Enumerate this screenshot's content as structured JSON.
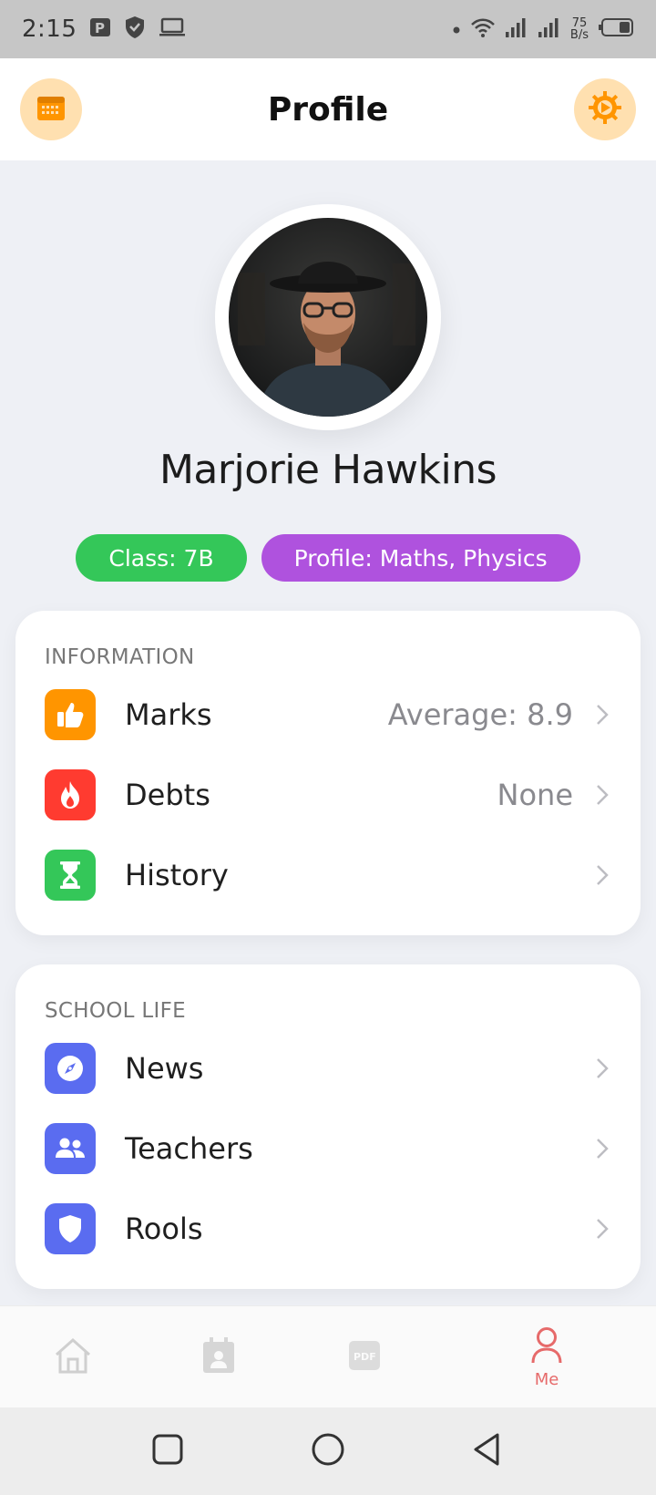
{
  "status_bar": {
    "time": "2:15",
    "network_speed_value": "75",
    "network_speed_unit": "B/s",
    "left_icons": [
      "parking-app-icon",
      "shield-icon",
      "laptop-icon"
    ],
    "right_icons": [
      "dot-icon",
      "wifi-icon",
      "signal-icon",
      "signal-icon",
      "battery-icon"
    ]
  },
  "header": {
    "title": "Profile",
    "left_button_icon": "calendar-icon",
    "right_button_icon": "settings-gear-icon"
  },
  "profile": {
    "name": "Marjorie Hawkins",
    "avatar": "profile-photo",
    "chips": [
      {
        "label": "Class: 7B",
        "color": "#34c759"
      },
      {
        "label": "Profile: Maths, Physics",
        "color": "#af52de"
      }
    ]
  },
  "information": {
    "title": "INFORMATION",
    "items": [
      {
        "label": "Marks",
        "value": "Average: 8.9",
        "icon": "thumbs-up-icon",
        "color": "#ff9500"
      },
      {
        "label": "Debts",
        "value": "None",
        "icon": "fire-icon",
        "color": "#ff3b30"
      },
      {
        "label": "History",
        "value": "",
        "icon": "hourglass-icon",
        "color": "#34c759"
      }
    ]
  },
  "school_life": {
    "title": "SCHOOL LIFE",
    "items": [
      {
        "label": "News",
        "icon": "compass-icon",
        "color": "#5a6cf0"
      },
      {
        "label": "Teachers",
        "icon": "people-icon",
        "color": "#5a6cf0"
      },
      {
        "label": "Rools",
        "icon": "shield-icon",
        "color": "#5a6cf0"
      }
    ]
  },
  "bottom_nav": {
    "items": [
      {
        "icon": "home-icon",
        "label": ""
      },
      {
        "icon": "schedule-icon",
        "label": ""
      },
      {
        "icon": "pdf-icon",
        "label": ""
      },
      {
        "icon": "person-icon",
        "label": "Me",
        "active": true
      }
    ],
    "active_color": "#e66a6a"
  },
  "system_nav": [
    "recents-button",
    "home-button",
    "back-button"
  ]
}
